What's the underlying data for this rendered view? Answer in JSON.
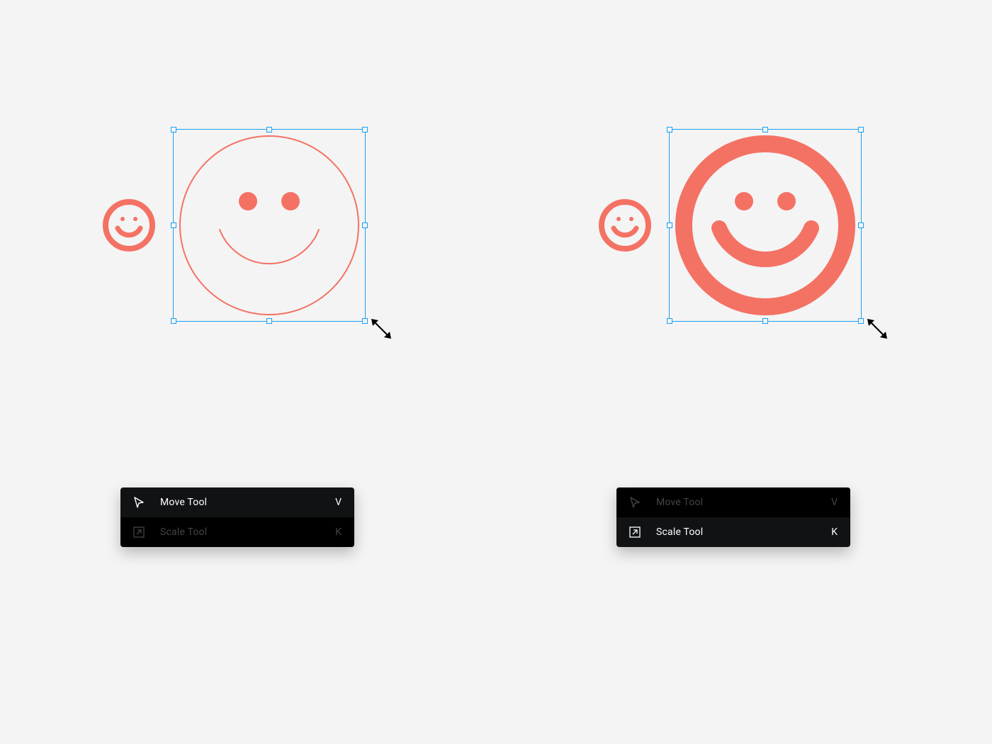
{
  "colors": {
    "coral": "#f47264",
    "selection": "#19a0f5",
    "popup": "#111214"
  },
  "tools": [
    {
      "id": "move",
      "label": "Move Tool",
      "shortcut": "V"
    },
    {
      "id": "scale",
      "label": "Scale Tool",
      "shortcut": "K"
    }
  ],
  "left_panel": {
    "active_tool": "move"
  },
  "right_panel": {
    "active_tool": "scale"
  }
}
